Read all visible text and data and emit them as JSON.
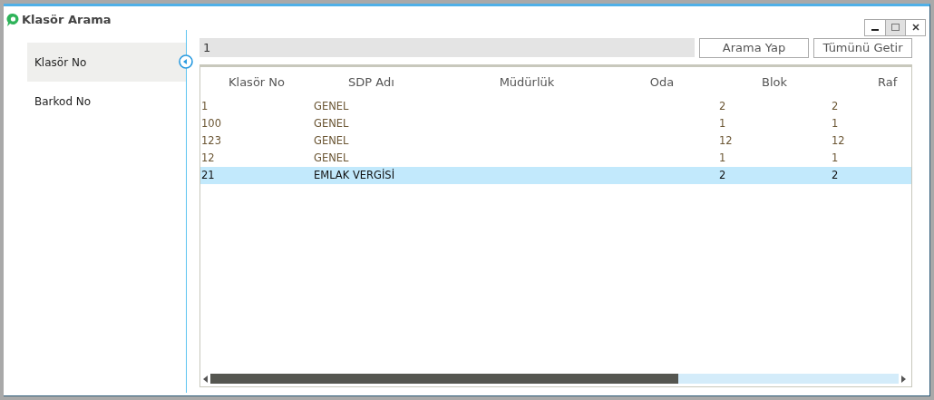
{
  "window": {
    "title": "Klasör Arama"
  },
  "sidebar": {
    "items": [
      {
        "label": "Klasör No",
        "selected": true
      },
      {
        "label": "Barkod No",
        "selected": false
      }
    ]
  },
  "search": {
    "value": "1"
  },
  "buttons": [
    "Arama Yap",
    "Tümünü Getir"
  ],
  "table": {
    "columns": [
      "Klasör No",
      "SDP Adı",
      "Müdürlük",
      "Oda",
      "Blok",
      "Raf"
    ],
    "rows": [
      {
        "cells": [
          "1",
          "GENEL",
          "",
          "",
          "2",
          "2"
        ],
        "selected": false
      },
      {
        "cells": [
          "100",
          "GENEL",
          "",
          "",
          "1",
          "1"
        ],
        "selected": false
      },
      {
        "cells": [
          "123",
          "GENEL",
          "",
          "",
          "12",
          "12"
        ],
        "selected": false
      },
      {
        "cells": [
          "12",
          "GENEL",
          "",
          "",
          "1",
          "1"
        ],
        "selected": false
      },
      {
        "cells": [
          "21",
          "EMLAK VERGİSİ",
          "",
          "",
          "2",
          "2"
        ],
        "selected": true
      }
    ]
  }
}
